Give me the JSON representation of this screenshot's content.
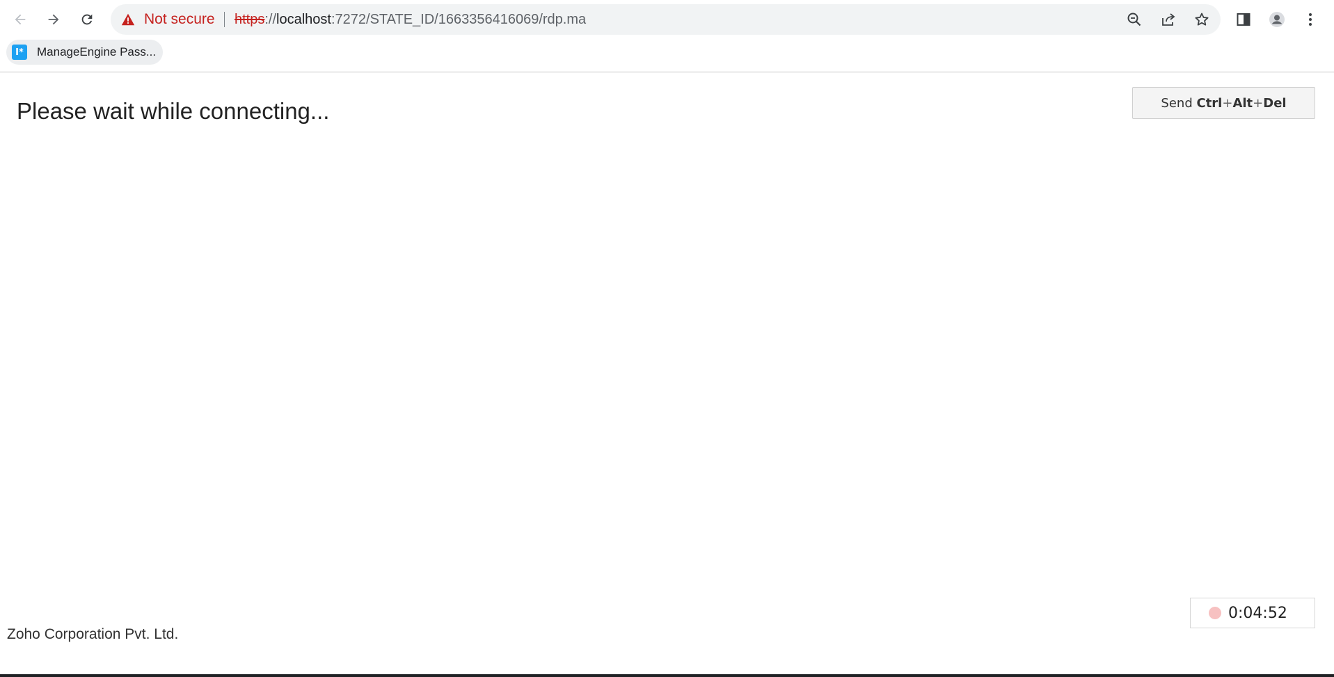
{
  "browser": {
    "security_label": "Not secure",
    "url_scheme": "https",
    "url_sep": "://",
    "url_host": "localhost",
    "url_rest": ":7272/STATE_ID/1663356416069/rdp.ma",
    "bookmark_label": "ManageEngine Pass...",
    "bookmark_favicon_text": "I*"
  },
  "page": {
    "status_message": "Please wait while connecting...",
    "cad_button": {
      "send": "Send",
      "ctrl": "Ctrl",
      "alt": "Alt",
      "del": "Del",
      "plus": "+"
    },
    "timer": "0:04:52",
    "footer_credit": "Zoho Corporation Pvt. Ltd."
  },
  "colors": {
    "security_warning": "#c5221f",
    "omnibox_bg": "#f1f3f4",
    "rec_dot": "#f7c1c1",
    "favicon": "#1da1f2"
  }
}
